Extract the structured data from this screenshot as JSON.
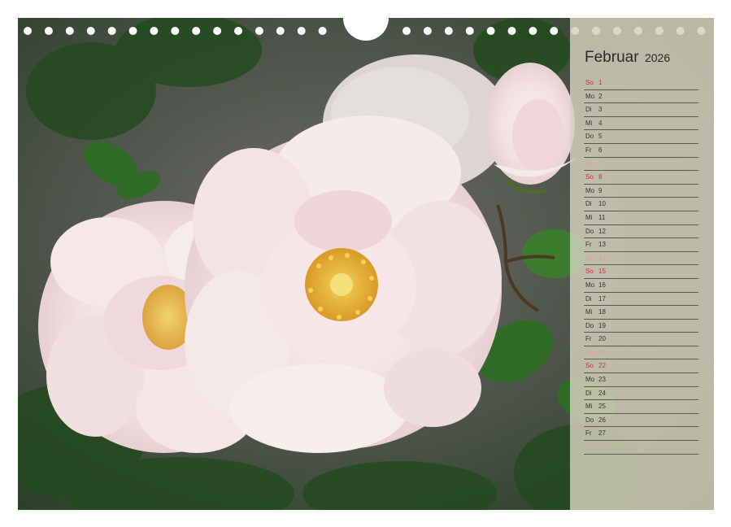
{
  "calendar": {
    "month": "Februar",
    "year": "2026",
    "days": [
      {
        "weekday": "So",
        "day": "1",
        "type": "sun"
      },
      {
        "weekday": "Mo",
        "day": "2",
        "type": "work"
      },
      {
        "weekday": "Di",
        "day": "3",
        "type": "work"
      },
      {
        "weekday": "Mi",
        "day": "4",
        "type": "work"
      },
      {
        "weekday": "Do",
        "day": "5",
        "type": "work"
      },
      {
        "weekday": "Fr",
        "day": "6",
        "type": "work"
      },
      {
        "weekday": "Sa",
        "day": "7",
        "type": "sat"
      },
      {
        "weekday": "So",
        "day": "8",
        "type": "sun"
      },
      {
        "weekday": "Mo",
        "day": "9",
        "type": "work"
      },
      {
        "weekday": "Di",
        "day": "10",
        "type": "work"
      },
      {
        "weekday": "Mi",
        "day": "11",
        "type": "work"
      },
      {
        "weekday": "Do",
        "day": "12",
        "type": "work"
      },
      {
        "weekday": "Fr",
        "day": "13",
        "type": "work"
      },
      {
        "weekday": "Sa",
        "day": "14",
        "type": "sat"
      },
      {
        "weekday": "So",
        "day": "15",
        "type": "sun"
      },
      {
        "weekday": "Mo",
        "day": "16",
        "type": "work"
      },
      {
        "weekday": "Di",
        "day": "17",
        "type": "work"
      },
      {
        "weekday": "Mi",
        "day": "18",
        "type": "work"
      },
      {
        "weekday": "Do",
        "day": "19",
        "type": "work"
      },
      {
        "weekday": "Fr",
        "day": "20",
        "type": "work"
      },
      {
        "weekday": "Sa",
        "day": "21",
        "type": "sat"
      },
      {
        "weekday": "So",
        "day": "22",
        "type": "sun"
      },
      {
        "weekday": "Mo",
        "day": "23",
        "type": "work"
      },
      {
        "weekday": "Di",
        "day": "24",
        "type": "work"
      },
      {
        "weekday": "Mi",
        "day": "25",
        "type": "work"
      },
      {
        "weekday": "Do",
        "day": "26",
        "type": "work"
      },
      {
        "weekday": "Fr",
        "day": "27",
        "type": "work"
      },
      {
        "weekday": "Sa",
        "day": "28",
        "type": "sat"
      }
    ]
  },
  "colors": {
    "sunday": "#c4323a",
    "saturday": "#d8a0a6",
    "weekday": "#333333",
    "panel": "#d6d1bd",
    "rose": "#f6ecec",
    "rose_shade": "#e8d2d4",
    "stamen": "#e2aa2c",
    "leaf": "#2f6a26"
  },
  "photo": {
    "subject": "pale pink roses with green leaves"
  }
}
